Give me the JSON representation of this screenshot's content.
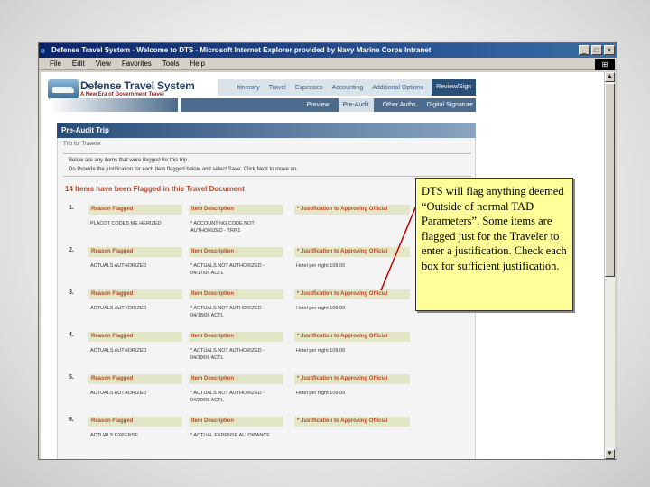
{
  "window": {
    "title": "Defense Travel System - Welcome to DTS - Microsoft Internet Explorer provided by Navy Marine Corps Intranet",
    "controls": [
      "_",
      "□",
      "×"
    ]
  },
  "menu": [
    "File",
    "Edit",
    "View",
    "Favorites",
    "Tools",
    "Help"
  ],
  "brand": {
    "title": "Defense Travel System",
    "subtitle": "A New Era of Government Travel"
  },
  "nav_primary": [
    "Itinerary",
    "Travel",
    "Expenses",
    "Accounting",
    "Additional Options",
    "Review/Sign"
  ],
  "nav_primary_active": "Review/Sign",
  "nav_secondary": [
    "Preview",
    "Pre-Audit",
    "Other Auths.",
    "Digital Signature"
  ],
  "nav_secondary_active": "Pre-Audit",
  "panel": {
    "title": "Pre-Audit Trip",
    "trip_line": "Trip for Traveler",
    "info_line1": "Below are any items that were flagged for this trip.",
    "info_line2": "Do Provide the justification for each item flagged below and select Save. Click Next to move on.",
    "flag_count_title": "14 Items have been Flagged in this Travel Document"
  },
  "columns": {
    "reason": "Reason Flagged",
    "description": "Item Description",
    "justification": "* Justification to Approving Official"
  },
  "items": [
    {
      "num": "1.",
      "reason": "PLACOT CODES ME HERIZED",
      "desc1": "* ACCOUNT NG CODE NOT",
      "desc2": "AUTHORIZED - TRP.1",
      "just": ""
    },
    {
      "num": "2.",
      "reason": "ACTUALS AUTHORIZED",
      "desc1": "* ACTUALS NOT AUTHORIZED -",
      "desc2": "04/17/06 ACTL",
      "just": "Hotel per night 109.00"
    },
    {
      "num": "3.",
      "reason": "ACTUALS AUTHORIZED",
      "desc1": "* ACTUALS NOT AUTHORIZED -",
      "desc2": "04/18/06 ACTL",
      "just": "Hotel per night 109.00"
    },
    {
      "num": "4.",
      "reason": "ACTUALS AUTHORIZED",
      "desc1": "* ACTUALS NOT AUTHORIZED -",
      "desc2": "04/19/06 ACTL",
      "just": "Hotel per night 109.00"
    },
    {
      "num": "5.",
      "reason": "ACTUALS AUTHORIZED",
      "desc1": "* ACTUALS NOT AUTHORIZED -",
      "desc2": "04/20/06 ACTL",
      "just": "Hotel per night 109.00"
    },
    {
      "num": "6.",
      "reason": "ACTUALS EXPENSE",
      "desc1": "* ACTUAL EXPENSE ALLOWANCE",
      "desc2": "",
      "just": ""
    }
  ],
  "callout": {
    "text": "DTS will flag anything deemed “Outside of normal TAD Parameters”.  Some items are flagged just for the Traveler to enter a justification. Check each box for sufficient justification."
  },
  "colors": {
    "titlebar": "#0a246a",
    "nav_dark": "#2c4f78",
    "column_header_bg": "#e3e6c7",
    "column_header_text": "#b2492a",
    "callout_bg": "#ffff99",
    "arrow": "#c00000"
  }
}
